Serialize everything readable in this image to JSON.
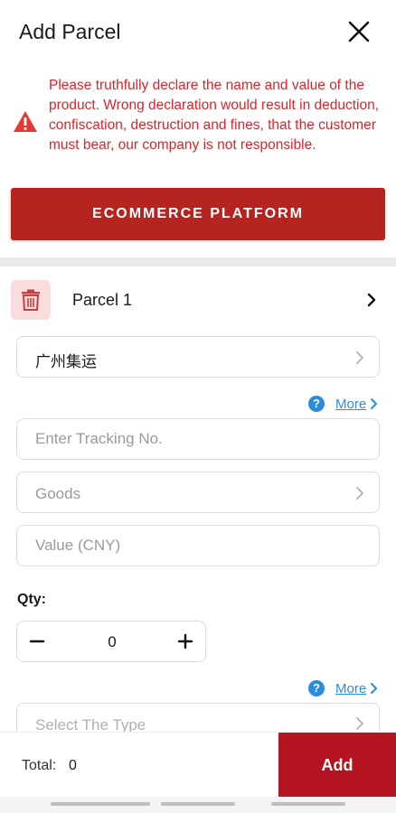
{
  "header": {
    "title": "Add Parcel"
  },
  "warning": {
    "text": "Please truthfully declare the name and value of the product. Wrong declaration would result in deduction, confiscation, destruction and fines, that the customer must bear, our company is not responsible.",
    "color": "#d8252b"
  },
  "platform_button": {
    "label": "ECOMMERCE PLATFORM",
    "color": "#b5241f"
  },
  "parcel": {
    "label": "Parcel 1",
    "warehouse": "广州集运",
    "more_label": "More",
    "tracking_placeholder": "Enter Tracking No.",
    "goods_placeholder": "Goods",
    "value_placeholder": "Value (CNY)",
    "qty_label": "Qty:",
    "qty_value": "0",
    "type_placeholder": "Select The Type"
  },
  "footer": {
    "total_label": "Total:",
    "total_value": "0",
    "add_label": "Add",
    "add_color": "#b3141f"
  },
  "icons": [
    "close-icon",
    "warning-icon",
    "trash-icon",
    "chevron-right-icon",
    "help-icon",
    "minus-icon",
    "plus-icon"
  ]
}
